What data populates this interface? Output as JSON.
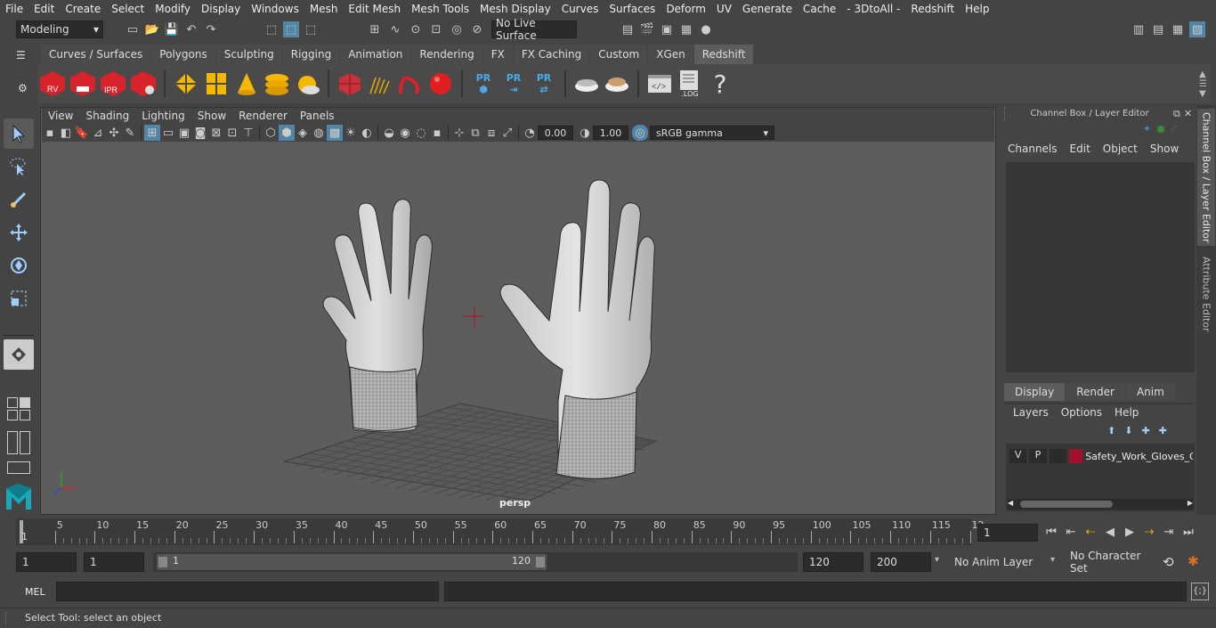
{
  "menubar": {
    "items": [
      "File",
      "Edit",
      "Create",
      "Select",
      "Modify",
      "Display",
      "Windows",
      "Mesh",
      "Edit Mesh",
      "Mesh Tools",
      "Mesh Display",
      "Curves",
      "Surfaces",
      "Deform",
      "UV",
      "Generate",
      "Cache",
      "- 3DtoAll -",
      "Redshift",
      "Help"
    ]
  },
  "statusline": {
    "mode": "Modeling",
    "live_surface": "No Live Surface"
  },
  "shelf": {
    "tabs": [
      "Curves / Surfaces",
      "Polygons",
      "Sculpting",
      "Rigging",
      "Animation",
      "Rendering",
      "FX",
      "FX Caching",
      "Custom",
      "XGen",
      "Redshift"
    ],
    "active_tab": "Redshift",
    "labels": {
      "rv": "RV",
      "ipr": "IPR",
      "pr1": "PR",
      "pr2": "PR",
      "pr3": "PR",
      "log": ".LOG",
      "help": "?"
    }
  },
  "viewport": {
    "menu": [
      "View",
      "Shading",
      "Lighting",
      "Show",
      "Renderer",
      "Panels"
    ],
    "exposure": "0.00",
    "gamma": "1.00",
    "color_space": "sRGB gamma",
    "camera_label": "persp"
  },
  "channelbox": {
    "title": "Channel Box / Layer Editor",
    "menu": [
      "Channels",
      "Edit",
      "Object",
      "Show"
    ],
    "layer_tabs": [
      "Display",
      "Render",
      "Anim"
    ],
    "active_layer_tab": "Display",
    "layer_menu": [
      "Layers",
      "Options",
      "Help"
    ],
    "layer": {
      "v": "V",
      "p": "P",
      "name": "Safety_Work_Gloves_G",
      "color": "#a0102a"
    }
  },
  "sidetabs": [
    "Channel Box / Layer Editor",
    "Attribute Editor"
  ],
  "timeline": {
    "ticks": [
      "5",
      "10",
      "15",
      "20",
      "25",
      "30",
      "35",
      "40",
      "45",
      "50",
      "55",
      "60",
      "65",
      "70",
      "75",
      "80",
      "85",
      "90",
      "95",
      "100",
      "105",
      "110",
      "115",
      "12"
    ],
    "start_marker": "1",
    "current_frame": "1"
  },
  "range": {
    "start": "1",
    "inner_start": "1",
    "slider_start": "1",
    "slider_end": "120",
    "end": "120",
    "outer_end": "200",
    "anim_layer": "No Anim Layer",
    "character_set": "No Character Set"
  },
  "mel": {
    "label": "MEL"
  },
  "helpline": {
    "text": "Select Tool: select an object"
  },
  "colors": {
    "accent": "#5285a6",
    "bg": "#444444",
    "viewport": "#5d5d5d"
  }
}
